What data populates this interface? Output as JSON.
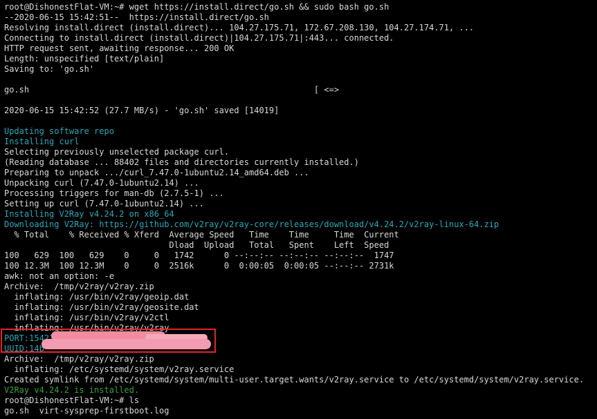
{
  "terminal": {
    "lines": [
      {
        "text": "root@DishonestFlat-VM:~# wget https://install.direct/go.sh && sudo bash go.sh",
        "color": "#d8d8d8"
      },
      {
        "text": "--2020-06-15 15:42:51--  https://install.direct/go.sh",
        "color": "#d8d8d8"
      },
      {
        "text": "Resolving install.direct (install.direct)... 104.27.175.71, 172.67.208.130, 104.27.174.71, ...",
        "color": "#d8d8d8"
      },
      {
        "text": "Connecting to install.direct (install.direct)|104.27.175.71|:443... connected.",
        "color": "#d8d8d8"
      },
      {
        "text": "HTTP request sent, awaiting response... 200 OK",
        "color": "#d8d8d8"
      },
      {
        "text": "Length: unspecified [text/plain]",
        "color": "#d8d8d8"
      },
      {
        "text": "Saving to: 'go.sh'",
        "color": "#d8d8d8"
      },
      {
        "text": "",
        "color": "#d8d8d8"
      },
      {
        "text": "go.sh                                                         [ <=>",
        "color": "#d8d8d8"
      },
      {
        "text": "",
        "color": "#d8d8d8"
      },
      {
        "text": "2020-06-15 15:42:52 (27.7 MB/s) - 'go.sh' saved [14019]",
        "color": "#d8d8d8"
      },
      {
        "text": "",
        "color": "#d8d8d8"
      },
      {
        "text": "Updating software repo",
        "color": "#2ba7b8"
      },
      {
        "text": "Installing curl",
        "color": "#2ba7b8"
      },
      {
        "text": "Selecting previously unselected package curl.",
        "color": "#d8d8d8"
      },
      {
        "text": "(Reading database ... 88402 files and directories currently installed.)",
        "color": "#d8d8d8"
      },
      {
        "text": "Preparing to unpack .../curl_7.47.0-1ubuntu2.14_amd64.deb ...",
        "color": "#d8d8d8"
      },
      {
        "text": "Unpacking curl (7.47.0-1ubuntu2.14) ...",
        "color": "#d8d8d8"
      },
      {
        "text": "Processing triggers for man-db (2.7.5-1) ...",
        "color": "#d8d8d8"
      },
      {
        "text": "Setting up curl (7.47.0-1ubuntu2.14) ...",
        "color": "#d8d8d8"
      },
      {
        "text": "Installing V2Ray v4.24.2 on x86_64",
        "color": "#2ba7b8"
      },
      {
        "text": "Downloading V2Ray: https://github.com/v2ray/v2ray-core/releases/download/v4.24.2/v2ray-linux-64.zip",
        "color": "#2ba7b8"
      },
      {
        "text": "  % Total    % Received % Xferd  Average Speed   Time    Time     Time  Current",
        "color": "#d8d8d8"
      },
      {
        "text": "                                 Dload  Upload   Total   Spent    Left  Speed",
        "color": "#d8d8d8"
      },
      {
        "text": "100   629  100   629    0     0   1742      0 --:--:-- --:--:-- --:--:--  1747",
        "color": "#d8d8d8"
      },
      {
        "text": "100 12.3M  100 12.3M    0     0  2516k      0  0:00:05  0:00:05 --:--:-- 2731k",
        "color": "#d8d8d8"
      },
      {
        "text": "awk: not an option: -e",
        "color": "#d8d8d8"
      },
      {
        "text": "Archive:  /tmp/v2ray/v2ray.zip",
        "color": "#d8d8d8"
      },
      {
        "text": "  inflating: /usr/bin/v2ray/geoip.dat",
        "color": "#d8d8d8"
      },
      {
        "text": "  inflating: /usr/bin/v2ray/geosite.dat",
        "color": "#d8d8d8"
      },
      {
        "text": "  inflating: /usr/bin/v2ray/v2ctl",
        "color": "#d8d8d8"
      },
      {
        "text": "  inflating: /usr/bin/v2ray/v2ray",
        "color": "#d8d8d8"
      },
      {
        "text": "PORT:15421",
        "color": "#2ba7b8"
      },
      {
        "text": "UUID:14b",
        "color": "#2ba7b8"
      },
      {
        "text": "Archive:  /tmp/v2ray/v2ray.zip",
        "color": "#d8d8d8"
      },
      {
        "text": "  inflating: /etc/systemd/system/v2ray.service",
        "color": "#d8d8d8"
      },
      {
        "text": "Created symlink from /etc/systemd/system/multi-user.target.wants/v2ray.service to /etc/systemd/system/v2ray.service.",
        "color": "#d8d8d8"
      },
      {
        "text": "V2Ray v4.24.2 is installed.",
        "color": "#3aa13a"
      },
      {
        "text": "root@DishonestFlat-VM:~# ls",
        "color": "#d8d8d8"
      },
      {
        "text": "go.sh  virt-sysprep-firstboot.log",
        "color": "#d8d8d8"
      }
    ]
  },
  "colors": {
    "background": "#000000",
    "text": "#d8d8d8",
    "info": "#2ba7b8",
    "success": "#3aa13a",
    "highlight_border": "#e0262a",
    "redaction": "#f18ba0"
  }
}
